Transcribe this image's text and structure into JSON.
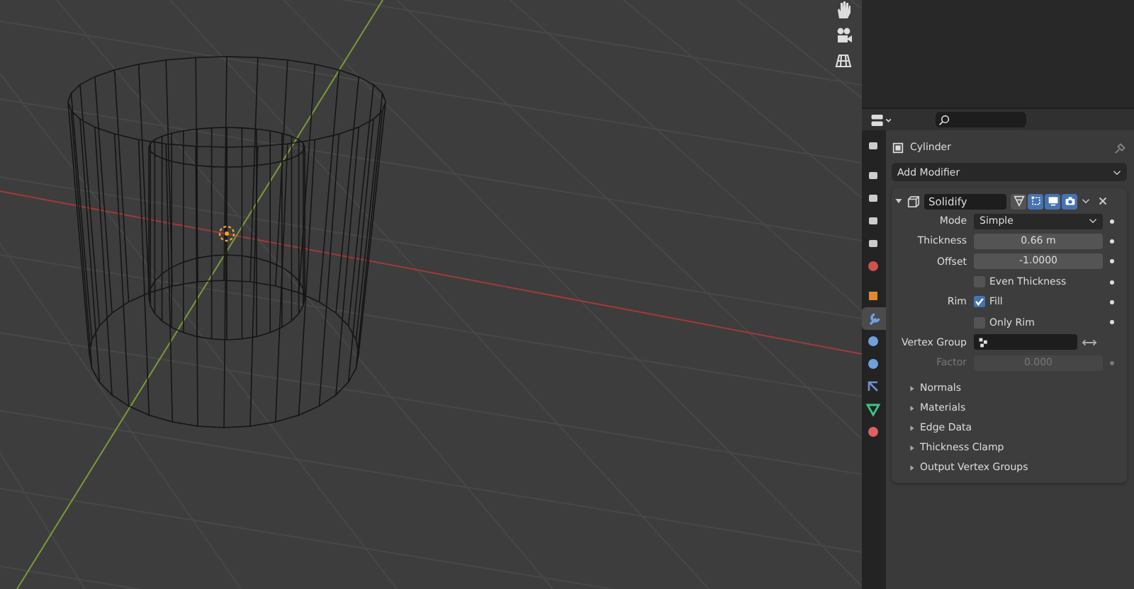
{
  "properties": {
    "tabs": [
      {
        "kind": "tool",
        "selected": false
      },
      {
        "kind": "render",
        "selected": false
      },
      {
        "kind": "output",
        "selected": false
      },
      {
        "kind": "view_layer",
        "selected": false
      },
      {
        "kind": "scene",
        "selected": false
      },
      {
        "kind": "world",
        "selected": false
      },
      {
        "kind": "object",
        "selected": false
      },
      {
        "kind": "modifiers",
        "selected": true
      },
      {
        "kind": "particles",
        "selected": false
      },
      {
        "kind": "physics",
        "selected": false
      },
      {
        "kind": "constraints",
        "selected": false
      },
      {
        "kind": "data",
        "selected": false
      },
      {
        "kind": "material",
        "selected": false
      }
    ],
    "object_name": "Cylinder",
    "add_modifier": "Add Modifier",
    "modifier": {
      "name": "Solidify",
      "expanded": true,
      "toggles": [
        {
          "kind": "cage",
          "on": false
        },
        {
          "kind": "edit_mode",
          "on": true
        },
        {
          "kind": "viewport",
          "on": true
        },
        {
          "kind": "render",
          "on": true
        }
      ],
      "rows": [
        {
          "kind": "dropdown",
          "label": "Mode",
          "value": "Simple"
        },
        {
          "kind": "number",
          "label": "Thickness",
          "value": "0.66 m",
          "disabled": false
        },
        {
          "kind": "number",
          "label": "Offset",
          "value": "-1.0000",
          "disabled": false
        },
        {
          "kind": "checkbox",
          "text": "Even Thickness",
          "checked": false
        },
        {
          "kind": "checkbox",
          "label": "Rim",
          "text": "Fill",
          "checked": true
        },
        {
          "kind": "checkbox",
          "text": "Only Rim",
          "checked": false
        },
        {
          "kind": "vertex_group",
          "label": "Vertex Group"
        },
        {
          "kind": "number",
          "label": "Factor",
          "value": "0.000",
          "disabled": true
        }
      ],
      "subpanels": [
        {
          "label": "Normals",
          "expanded": false
        },
        {
          "label": "Materials",
          "expanded": false
        },
        {
          "label": "Edge Data",
          "expanded": false
        },
        {
          "label": "Thickness Clamp",
          "expanded": false
        },
        {
          "label": "Output Vertex Groups",
          "expanded": false
        }
      ]
    }
  }
}
